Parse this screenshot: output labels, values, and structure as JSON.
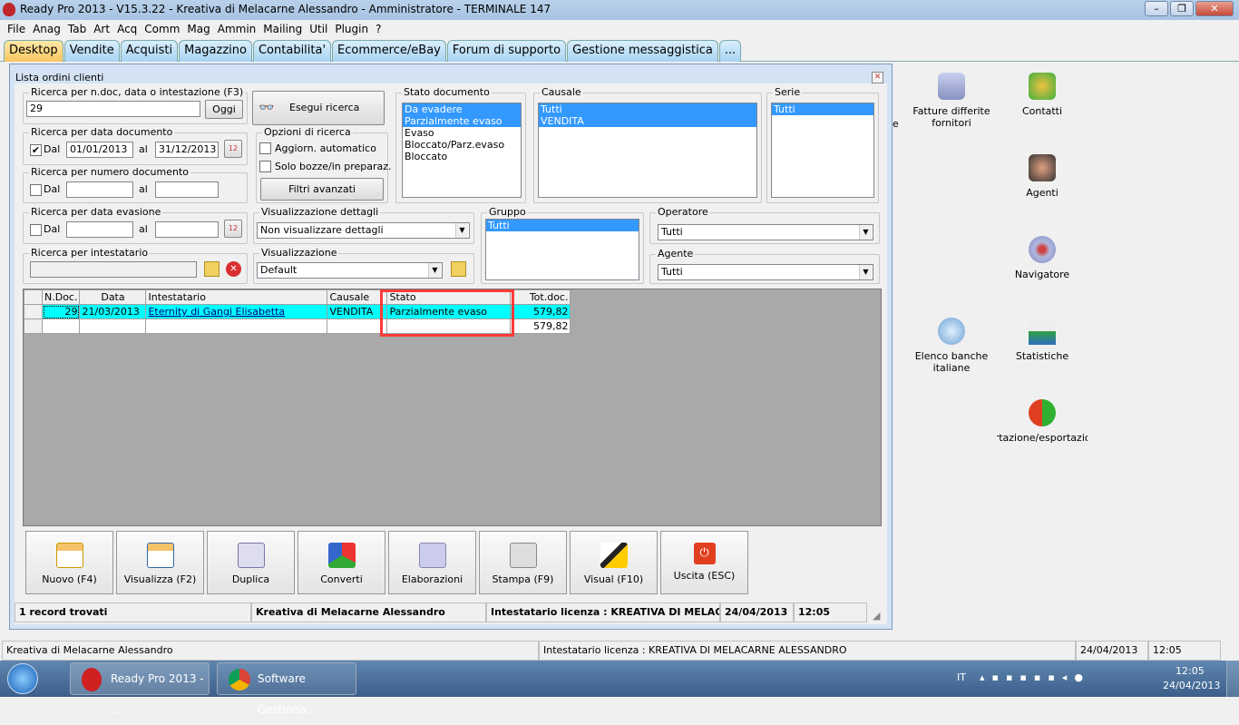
{
  "app": {
    "title": "Ready Pro 2013 - V15.3.22 - Kreativa di Melacarne Alessandro - Amministratore - TERMINALE 147"
  },
  "menu": [
    "File",
    "Anag",
    "Tab",
    "Art",
    "Acq",
    "Comm",
    "Mag",
    "Ammin",
    "Mailing",
    "Util",
    "Plugin",
    "?"
  ],
  "tabs": [
    "Desktop",
    "Vendite",
    "Acquisti",
    "Magazzino",
    "Contabilita'",
    "Ecommerce/eBay",
    "Forum di supporto",
    "Gestione messaggistica",
    "..."
  ],
  "window": {
    "title": "Lista ordini clienti",
    "search": {
      "legend": "Ricerca per n.doc, data o intestazione (F3)",
      "value": "29",
      "today": "Oggi",
      "run": "Esegui ricerca"
    },
    "doc_date": {
      "legend": "Ricerca per data documento",
      "from_label": "Dal",
      "from": "01/01/2013",
      "to_label": "al",
      "to": "31/12/2013",
      "checked": true
    },
    "doc_num": {
      "legend": "Ricerca per numero documento",
      "from_label": "Dal",
      "to_label": "al"
    },
    "ev_date": {
      "legend": "Ricerca per data evasione",
      "from_label": "Dal",
      "to_label": "al"
    },
    "holder": {
      "legend": "Ricerca per intestatario"
    },
    "options": {
      "legend": "Opzioni di ricerca",
      "auto": "Aggiorn. automatico",
      "drafts": "Solo bozze/in preparaz.",
      "advanced": "Filtri avanzati"
    },
    "stato": {
      "legend": "Stato documento",
      "items": [
        "Da evadere",
        "Parzialmente evaso",
        "Evaso",
        "Bloccato/Parz.evaso",
        "Bloccato"
      ]
    },
    "causale": {
      "legend": "Causale",
      "items": [
        "Tutti",
        "VENDITA"
      ]
    },
    "serie": {
      "legend": "Serie",
      "items": [
        "Tutti"
      ]
    },
    "details": {
      "legend": "Visualizzazione dettagli",
      "value": "Non visualizzare dettagli"
    },
    "view": {
      "legend": "Visualizzazione",
      "value": "Default"
    },
    "gruppo": {
      "legend": "Gruppo",
      "items": [
        "Tutti"
      ]
    },
    "operatore": {
      "legend": "Operatore",
      "value": "Tutti"
    },
    "agente": {
      "legend": "Agente",
      "value": "Tutti"
    },
    "table": {
      "headers": [
        "N.Doc.",
        "Data",
        "Intestatario",
        "Causale",
        "Stato",
        "Tot.doc."
      ],
      "rows": [
        [
          "29",
          "21/03/2013",
          "Eternity di Gangi Elisabetta",
          "VENDITA",
          "Parzialmente evaso",
          "579,82"
        ]
      ],
      "total": "579,82"
    },
    "buttons": [
      "Nuovo (F4)",
      "Visualizza (F2)",
      "Duplica",
      "Converti",
      "Elaborazioni",
      "Stampa (F9)",
      "Visual (F10)",
      "Uscita (ESC)"
    ],
    "status": [
      "1 record trovati",
      "Kreativa di Melacarne Alessandro",
      "Intestatario licenza : KREATIVA DI MELACARNE ALESSANDRO",
      "24/04/2013",
      "12:05"
    ]
  },
  "desktop": {
    "partial": "e",
    "icons": [
      "Fatture differite fornitori",
      "Contatti",
      "Agenti",
      "Navigatore",
      "Elenco banche italiane",
      "Statistiche",
      "Importazione/esportazione dati"
    ]
  },
  "mainstatus": [
    "Kreativa di Melacarne Alessandro",
    "Intestatario licenza : KREATIVA DI MELACARNE ALESSANDRO",
    "24/04/2013",
    "12:05"
  ],
  "taskbar": {
    "tasks": [
      "Ready Pro 2013 - ...",
      "Software Gestiona..."
    ],
    "lang": "IT",
    "time": "12:05",
    "date": "24/04/2013"
  },
  "colors": {
    "selection": "#3399ff",
    "highlight_row": "#00ffff",
    "highlight_box": "#ff3b3b"
  }
}
